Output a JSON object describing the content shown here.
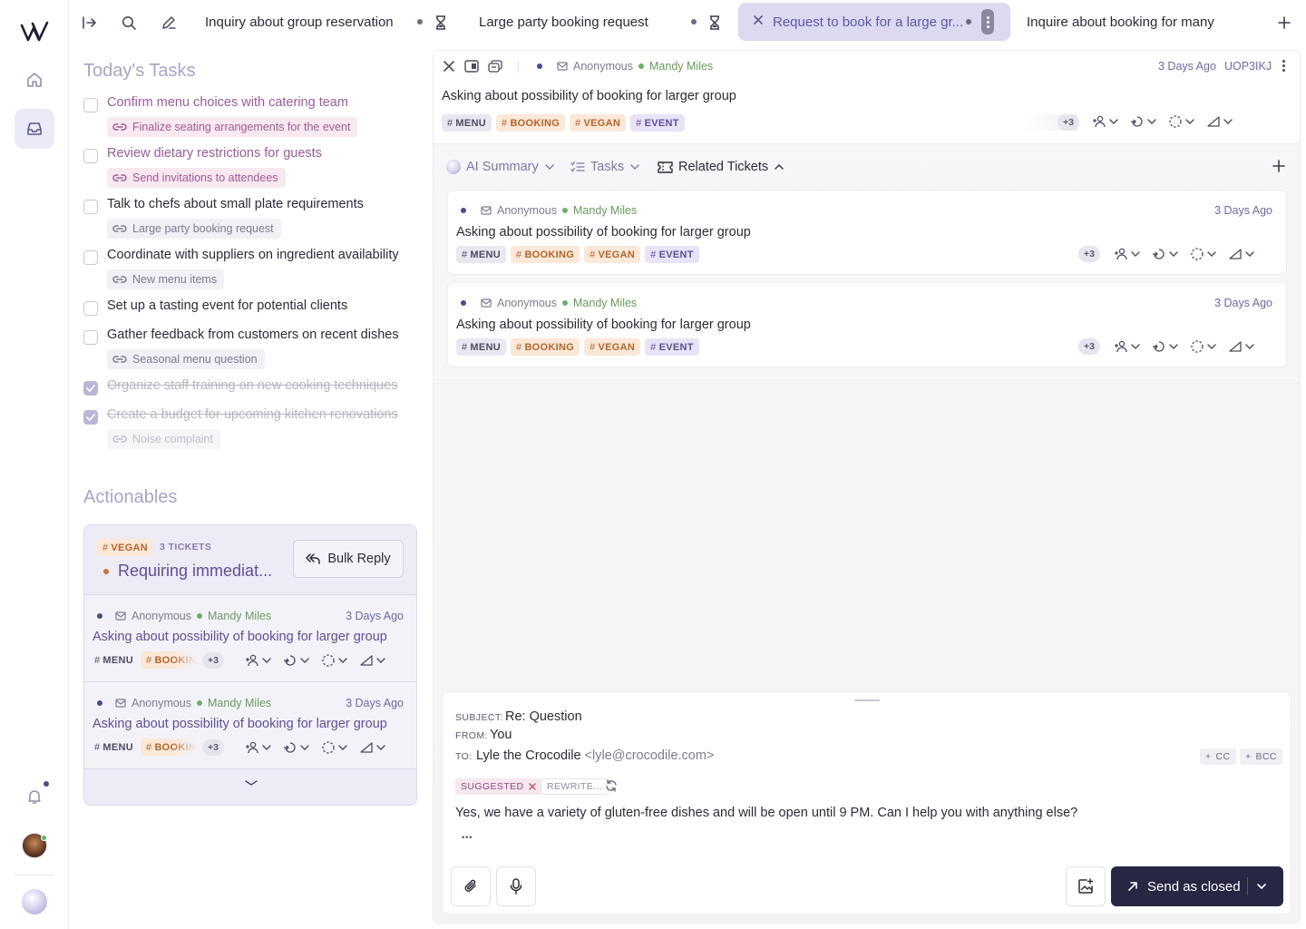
{
  "topbar": {
    "tabs": [
      {
        "label": "Inquiry about group reservation"
      },
      {
        "label": "Large party booking request"
      },
      {
        "label": "Request to book for a large gr..."
      },
      {
        "label": "Inquire about booking for many"
      }
    ]
  },
  "tasks": {
    "title": "Today's Tasks",
    "items": [
      {
        "text": "Confirm menu choices with catering team",
        "link": "Finalize seating arrangements for the event"
      },
      {
        "text": "Review dietary restrictions for guests",
        "link": "Send invitations to attendees"
      },
      {
        "text": "Talk to chefs about small plate requirements",
        "link": "Large party booking request"
      },
      {
        "text": "Coordinate with suppliers on ingredient availability",
        "link": "New menu items"
      },
      {
        "text": "Set up a tasting event for potential clients"
      },
      {
        "text": "Gather feedback from customers on recent dishes",
        "link": "Seasonal menu question"
      },
      {
        "text": "Organize staff training on new cooking techniques"
      },
      {
        "text": "Create a budget for upcoming kitchen renovations",
        "link": "Noise complaint"
      }
    ]
  },
  "actionables": {
    "title": "Actionables",
    "group_tag": "VEGAN",
    "ticket_count": "3 TICKETS",
    "group_title": "Requiring immediat...",
    "bulk_reply": "Bulk Reply",
    "cards": [
      {
        "author": "Anonymous",
        "assignee": "Mandy Miles",
        "time": "3 Days Ago",
        "subject": "Asking about possibility of booking for larger group",
        "tag1": "MENU",
        "tag2": "BOOKING",
        "more": "+3"
      },
      {
        "author": "Anonymous",
        "assignee": "Mandy Miles",
        "time": "3 Days Ago",
        "subject": "Asking about possibility of booking for larger group",
        "tag1": "MENU",
        "tag2": "BOOKING",
        "more": "+3"
      }
    ]
  },
  "ticket": {
    "author": "Anonymous",
    "assignee": "Mandy Miles",
    "time": "3 Days Ago",
    "id": "UOP3IKJ",
    "subject": "Asking about possibility of booking for larger group",
    "tags": [
      "MENU",
      "BOOKING",
      "VEGAN",
      "EVENT"
    ],
    "more": "+3",
    "section_tabs": {
      "ai_summary": "AI Summary",
      "tasks": "Tasks",
      "related": "Related Tickets"
    }
  },
  "related": [
    {
      "author": "Anonymous",
      "assignee": "Mandy Miles",
      "time": "3 Days Ago",
      "subject": "Asking about possibility of booking for larger group",
      "tags": [
        "MENU",
        "BOOKING",
        "VEGAN",
        "EVENT"
      ],
      "more": "+3"
    },
    {
      "author": "Anonymous",
      "assignee": "Mandy Miles",
      "time": "3 Days Ago",
      "subject": "Asking about possibility of booking for larger group",
      "tags": [
        "MENU",
        "BOOKING",
        "VEGAN",
        "EVENT"
      ],
      "more": "+3"
    }
  ],
  "compose": {
    "subject_label": "SUBJECT:",
    "subject": "Re: Question",
    "from_label": "FROM:",
    "from": "You",
    "to_label": "TO:",
    "to_name": "Lyle the Crocodile",
    "to_email": "<lyle@crocodile.com>",
    "cc": "CC",
    "bcc": "BCC",
    "suggested": "SUGGESTED",
    "rewrite": "REWRITE...",
    "body": "Yes, we have a variety of gluten-free dishes and will be open until 9 PM. Can I help you with anything else?",
    "ellipsis": "•••",
    "send_label": "Send as closed"
  },
  "colors": {
    "accent": "#272744",
    "tab_active": "#dcd9f0",
    "purple_text": "#9b5a9c"
  }
}
